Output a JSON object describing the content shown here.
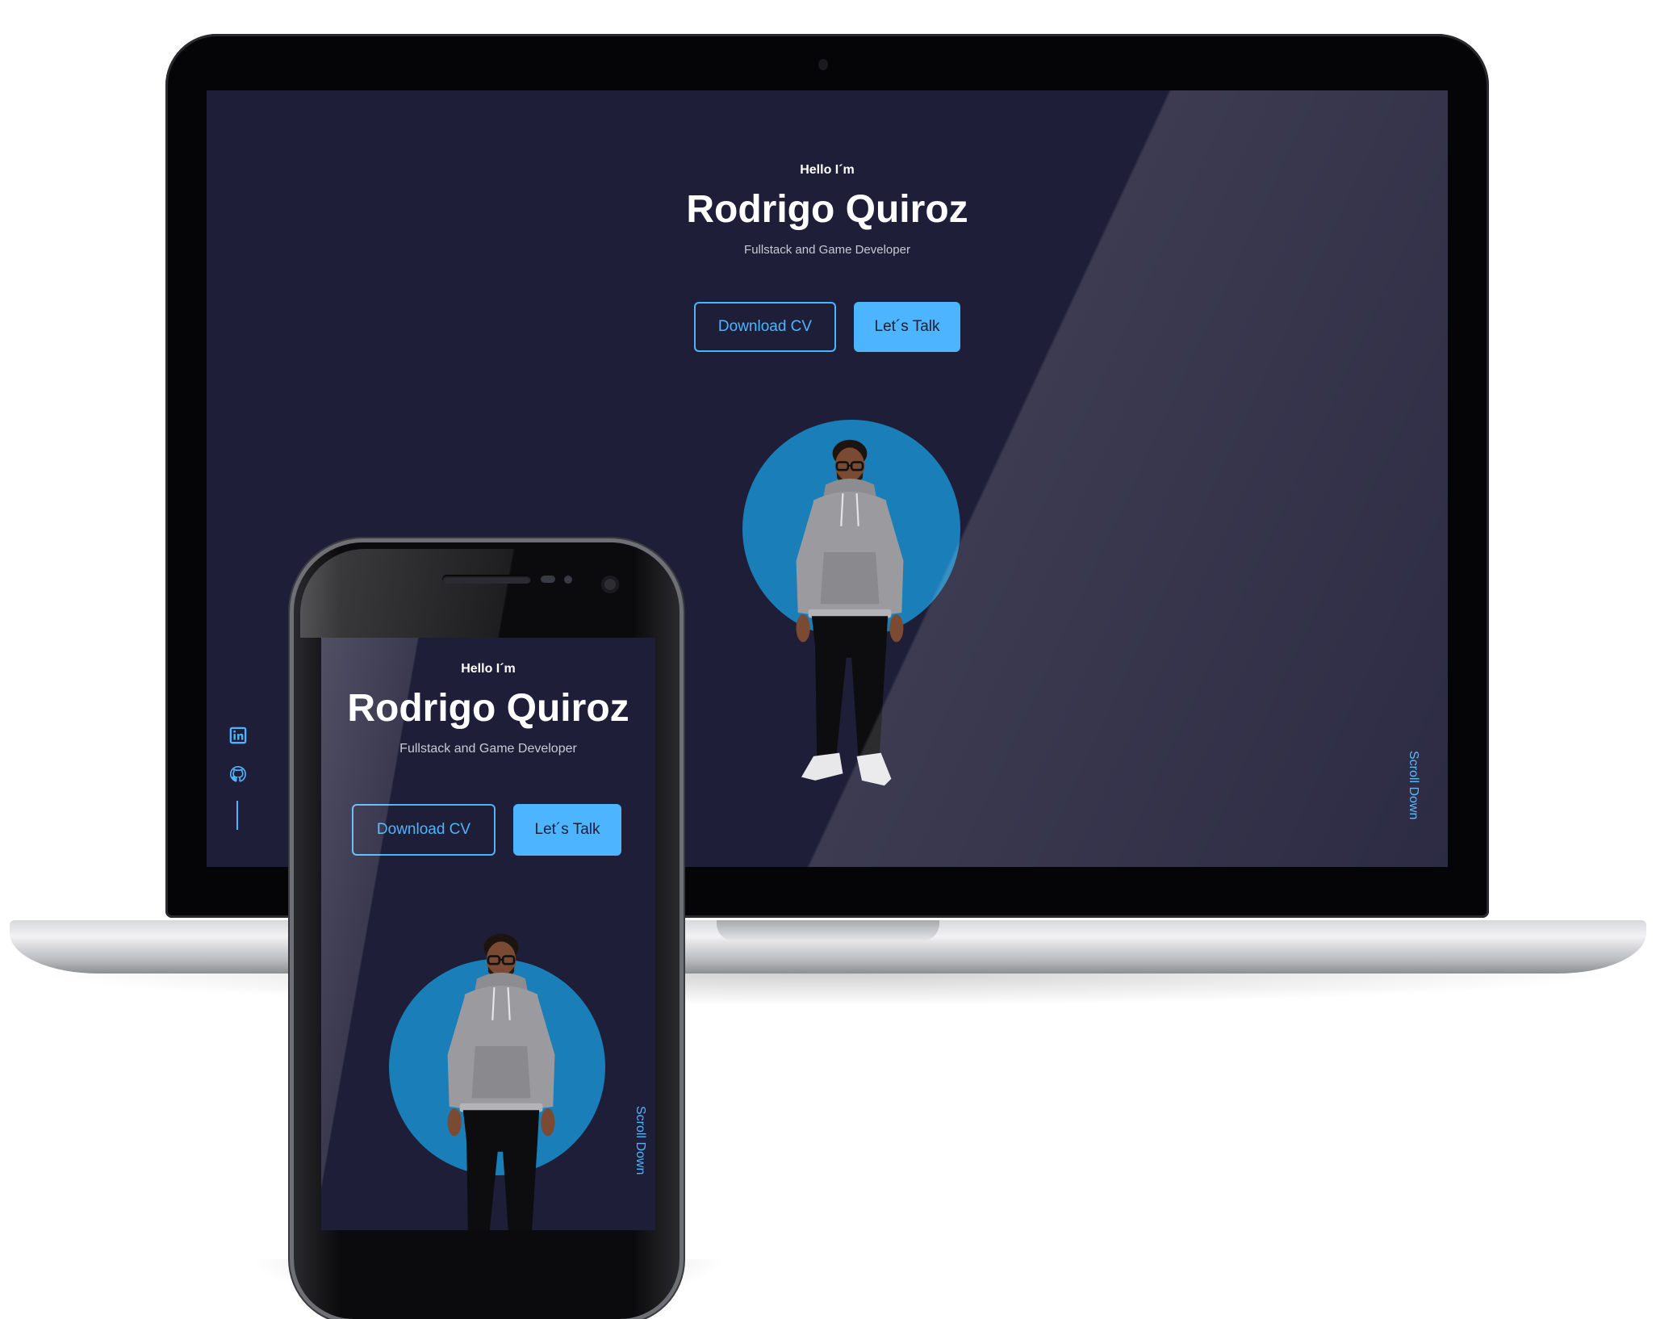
{
  "hero": {
    "greeting": "Hello I´m",
    "name": "Rodrigo Quiroz",
    "role": "Fullstack and Game Developer",
    "download_cv_label": "Download CV",
    "lets_talk_label": "Let´s Talk",
    "scroll_down_label": "Scroll Down"
  },
  "social": {
    "icons": [
      "linkedin-icon",
      "github-icon"
    ]
  },
  "colors": {
    "background": "#1f1e38",
    "accent": "#4db5ff",
    "avatar_circle": "#1a7fb8",
    "text": "#ffffff"
  }
}
